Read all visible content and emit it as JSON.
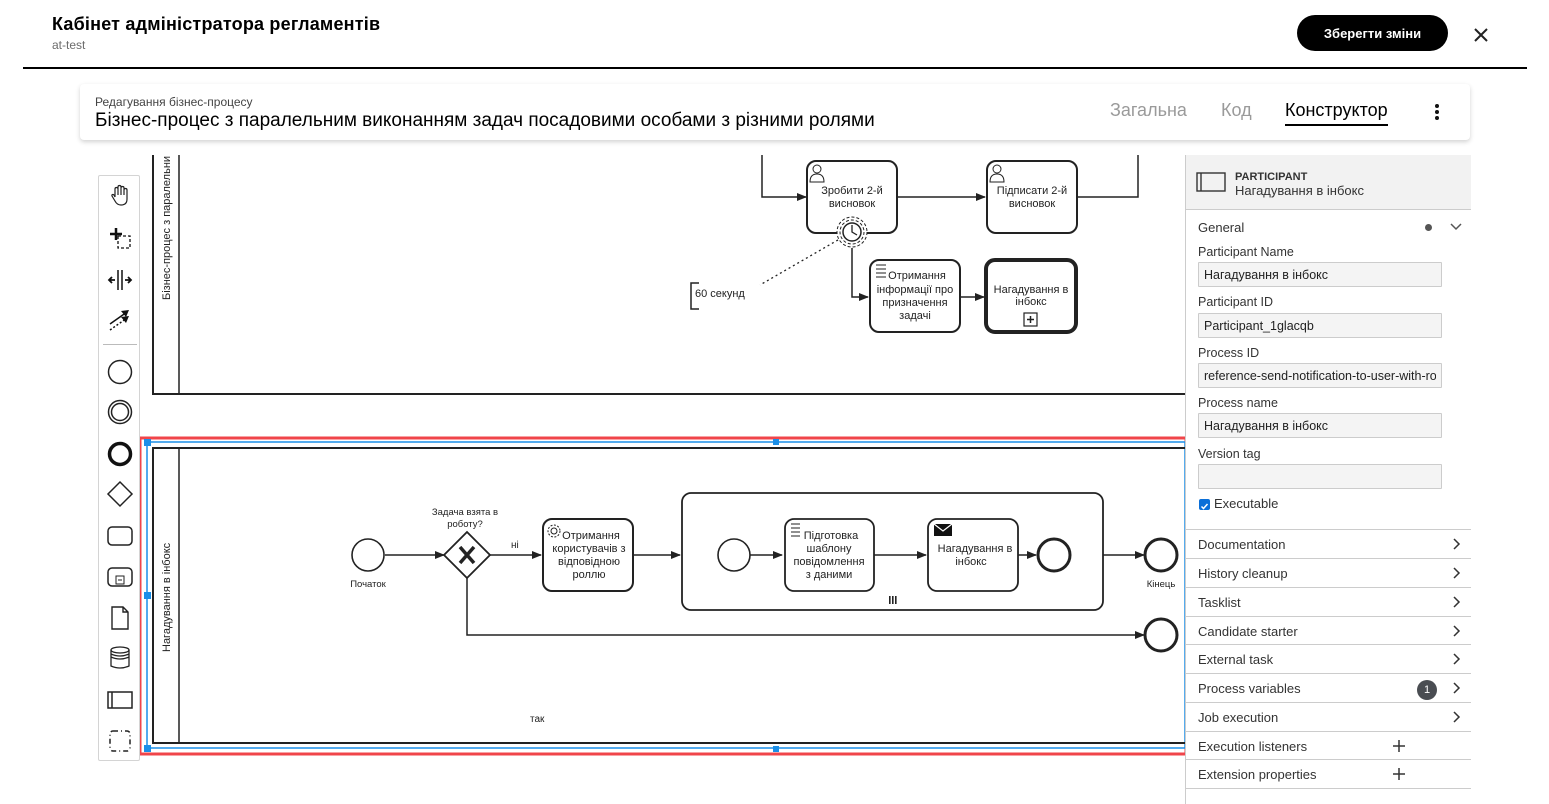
{
  "app": {
    "title": "Кабінет адміністратора регламентів",
    "subtitle": "at-test",
    "save_label": "Зберегти зміни",
    "close_icon": "close-icon"
  },
  "header": {
    "breadcrumb": "Редагування бізнес-процесу",
    "title": "Бізнес-процес з паралельним виконанням задач посадовими особами з різними ролями",
    "tabs": [
      {
        "label": "Загальна",
        "active": false
      },
      {
        "label": "Код",
        "active": false
      },
      {
        "label": "Конструктор",
        "active": true
      }
    ],
    "menu_icon": "more-vertical-icon"
  },
  "palette": {
    "tools": [
      "hand-tool",
      "lasso-tool",
      "space-tool",
      "global-connect-tool"
    ],
    "elements": [
      "start-event",
      "intermediate-event",
      "end-event",
      "gateway",
      "task",
      "subprocess",
      "data-object",
      "data-store",
      "participant",
      "group"
    ]
  },
  "diagram": {
    "pool_top": {
      "label": "Бізнес-процес з паралельни",
      "tasks": [
        {
          "label_1": "Зробити 2-й",
          "label_2": "висновок",
          "type": "user-task"
        },
        {
          "label_1": "Підписати 2-й",
          "label_2": "висновок",
          "type": "user-task"
        },
        {
          "label_1": "Отримання",
          "label_2": "інформації про",
          "label_3": "призначення",
          "label_4": "задачі",
          "type": "script-task"
        },
        {
          "label_1": "Нагадування в",
          "label_2": "інбокс",
          "type": "call-activity"
        }
      ],
      "timer_annotation": "60 секунд"
    },
    "pool_bottom": {
      "label": "Нагадування в інбокс",
      "start_label": "Початок",
      "gateway_label_1": "Задача взята в",
      "gateway_label_2": "роботу?",
      "flow_no": "ні",
      "flow_yes": "так",
      "service_task": {
        "label_1": "Отримання",
        "label_2": "користувачів з",
        "label_3": "відповідною",
        "label_4": "роллю"
      },
      "sub_script_task": {
        "label_1": "Підготовка",
        "label_2": "шаблону",
        "label_3": "повідомлення",
        "label_4": "з даними"
      },
      "sub_send_task": {
        "label_1": "Нагадування в",
        "label_2": "інбокс"
      },
      "end_label": "Кінець"
    }
  },
  "properties": {
    "element_type": "PARTICIPANT",
    "element_name": "Нагадування в інбокс",
    "group_title": "General",
    "fields": [
      {
        "label": "Participant Name",
        "value": "Нагадування в інбокс"
      },
      {
        "label": "Participant ID",
        "value": "Participant_1glacqb"
      },
      {
        "label": "Process ID",
        "value": "reference-send-notification-to-user-with-role"
      },
      {
        "label": "Process name",
        "value": "Нагадування в інбокс"
      },
      {
        "label": "Version tag",
        "value": ""
      }
    ],
    "executable_label": "Executable",
    "executable_checked": true,
    "sections": [
      {
        "label": "Documentation",
        "action": "chevron"
      },
      {
        "label": "History cleanup",
        "action": "chevron"
      },
      {
        "label": "Tasklist",
        "action": "chevron"
      },
      {
        "label": "Candidate starter",
        "action": "chevron"
      },
      {
        "label": "External task",
        "action": "chevron"
      },
      {
        "label": "Process variables",
        "action": "chevron",
        "badge": "1"
      },
      {
        "label": "Job execution",
        "action": "chevron"
      },
      {
        "label": "Execution listeners",
        "action": "plus"
      },
      {
        "label": "Extension properties",
        "action": "plus"
      }
    ]
  },
  "colors": {
    "selection_outline": "#f0454a",
    "selection_line": "#1b8fe8",
    "checkbox": "#0b6fd8",
    "badge": "#4a4d52"
  }
}
